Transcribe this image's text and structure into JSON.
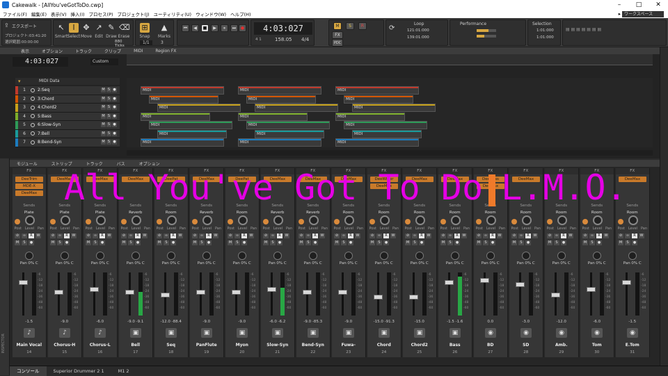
{
  "titlebar": {
    "title": "Cakewalk - [AllYou'veGotToDo.cwp]"
  },
  "menu": {
    "items": [
      "ファイル(F)",
      "編集(E)",
      "表示(V)",
      "挿入(I)",
      "プロセス(P)",
      "プロジェクト(J)",
      "ユーティリティ(U)",
      "ウィンドウ(W)",
      "ヘルプ(H)"
    ],
    "workspace_label": "ワークスペース"
  },
  "control": {
    "export_label": "エクスポート",
    "project_line": "プロジェクト:03:41:20",
    "selection_line": "選択範囲:00:00:00",
    "tools": [
      "Smart",
      "Select",
      "Move",
      "Edit",
      "Draw",
      "Erase"
    ],
    "snap_label": "Snap",
    "snap_value": "1/1",
    "marks_label": "Marks",
    "ticks_value": "880 Ticks",
    "marks_value": "3",
    "time": "4:03:027",
    "bpm": "158.05",
    "meter": "4/4",
    "bar_info": "4 1",
    "loop_title": "Loop",
    "loop_start": "121:01:000",
    "loop_end": "139:01:000",
    "performance_title": "Performance",
    "selection_title": "Selection",
    "sel_start": "1:01:000",
    "sel_end": "1:01:000",
    "mode_buttons": [
      "M",
      "S",
      "R",
      "FX",
      "PDC"
    ]
  },
  "trackview": {
    "menu": [
      "表示",
      "オプション",
      "トラック",
      "クリップ",
      "MIDI",
      "Region FX"
    ],
    "clock": "4:03:027",
    "preset": "Custom",
    "folder_name": "MIDI Data",
    "tracks": [
      {
        "num": "1",
        "name": "2:Seq",
        "color": "#c0392b"
      },
      {
        "num": "2",
        "name": "3:Chord",
        "color": "#d35400"
      },
      {
        "num": "3",
        "name": "4:Chord2",
        "color": "#c8a21a"
      },
      {
        "num": "4",
        "name": "5:Bass",
        "color": "#7cae2a"
      },
      {
        "num": "5",
        "name": "6:Slow-Syn",
        "color": "#2e9a58"
      },
      {
        "num": "6",
        "name": "7:Bell",
        "color": "#1a9a9a"
      },
      {
        "num": "7",
        "name": "8:Bend-Syn",
        "color": "#1c7cbf"
      }
    ],
    "clip_label": "MIDI"
  },
  "console": {
    "menu": [
      "モジュール",
      "ストリップ",
      "トラック",
      "バス",
      "オプション"
    ],
    "strips": [
      {
        "name": "Main Vocal",
        "num": "14",
        "fx": [
          "DeeTrim",
          "MDE-X",
          "DeeMax"
        ],
        "send": "Plate",
        "vol": "-1.5",
        "vol2": "",
        "fader": 0.8,
        "meter": 0,
        "inst": "♪"
      },
      {
        "name": "Chorus-H",
        "num": "15",
        "fx": [
          "DeeMax"
        ],
        "send": "Plate",
        "vol": "-9.0",
        "vol2": "",
        "fader": 0.55,
        "meter": 0,
        "inst": "♪"
      },
      {
        "name": "Chorus-L",
        "num": "16",
        "fx": [
          "DeeMax"
        ],
        "send": "Plate",
        "vol": "-6.0",
        "vol2": "",
        "fader": 0.62,
        "meter": 0,
        "inst": "♪"
      },
      {
        "name": "Bell",
        "num": "17",
        "fx": [
          "DeeMax"
        ],
        "send": "Reverb",
        "vol": "-9.0",
        "vol2": "-9.1",
        "fader": 0.55,
        "meter": 0.55,
        "inst": "▣"
      },
      {
        "name": "Seq",
        "num": "18",
        "fx": [
          "DeePat"
        ],
        "send": "Room",
        "vol": "-12.0",
        "vol2": "-88.4",
        "fader": 0.48,
        "meter": 0,
        "inst": "▣"
      },
      {
        "name": "PanFlute",
        "num": "19",
        "fx": [
          "DeeMax"
        ],
        "send": "Reverb",
        "vol": "-9.0",
        "vol2": "",
        "fader": 0.55,
        "meter": 0,
        "inst": "▣"
      },
      {
        "name": "Myon",
        "num": "20",
        "fx": [
          "DeePat"
        ],
        "send": "Room",
        "vol": "-9.0",
        "vol2": "",
        "fader": 0.55,
        "meter": 0,
        "inst": "▣"
      },
      {
        "name": "Slow-Syn",
        "num": "21",
        "fx": [
          "DeeMax"
        ],
        "send": "Reverb",
        "vol": "-6.0",
        "vol2": "-6.2",
        "fader": 0.62,
        "meter": 0.65,
        "inst": "▣"
      },
      {
        "name": "Bend-Syn",
        "num": "22",
        "fx": [
          "DeeMax"
        ],
        "send": "Reverb",
        "vol": "-9.0",
        "vol2": "-85.3",
        "fader": 0.55,
        "meter": 0,
        "inst": "▣"
      },
      {
        "name": "Fuwa-",
        "num": "23",
        "fx": [
          "DeeMax"
        ],
        "send": "Room",
        "vol": "-9.0",
        "vol2": "",
        "fader": 0.55,
        "meter": 0,
        "inst": "▣"
      },
      {
        "name": "Chord",
        "num": "24",
        "fx": [
          "DeeWider",
          "DeeMax"
        ],
        "send": "Room",
        "vol": "-15.0",
        "vol2": "-91.3",
        "fader": 0.42,
        "meter": 0,
        "inst": "▣"
      },
      {
        "name": "Chord2",
        "num": "25",
        "fx": [
          "DeeMax"
        ],
        "send": "Room",
        "vol": "-15.0",
        "vol2": "",
        "fader": 0.42,
        "meter": 0,
        "inst": "▣"
      },
      {
        "name": "Bass",
        "num": "26",
        "fx": [
          "DeeMax"
        ],
        "send": "Room",
        "vol": "-1.5",
        "vol2": "-1.6",
        "fader": 0.8,
        "meter": 0.9,
        "inst": "▣"
      },
      {
        "name": "BD",
        "num": "27",
        "fx": [
          "DeeBass",
          "DeeMax"
        ],
        "send": "Room",
        "vol": "0.0",
        "vol2": "",
        "fader": 0.85,
        "meter": 0,
        "inst": "◉"
      },
      {
        "name": "SD",
        "num": "28",
        "fx": [
          "DeeMax"
        ],
        "send": "Room",
        "vol": "-3.0",
        "vol2": "",
        "fader": 0.75,
        "meter": 0,
        "inst": "◉"
      },
      {
        "name": "Amb.",
        "num": "29",
        "fx": [],
        "send": "Room",
        "vol": "-12.0",
        "vol2": "",
        "fader": 0.48,
        "meter": 0,
        "inst": "◉"
      },
      {
        "name": "Tom",
        "num": "30",
        "fx": [],
        "send": "Room",
        "vol": "-6.0",
        "vol2": "",
        "fader": 0.62,
        "meter": 0,
        "inst": "◉"
      },
      {
        "name": "E.Tom",
        "num": "31",
        "fx": [
          "DeeMax"
        ],
        "send": "Room",
        "vol": "-1.5",
        "vol2": "",
        "fader": 0.8,
        "meter": 0,
        "inst": "◉"
      }
    ],
    "fx_header": "FX",
    "sends_label": "Sends",
    "knob_labels": [
      "Post",
      "Level",
      "Pan"
    ],
    "pan_label": "Pan 0% C",
    "meter_ticks": [
      "-6",
      "-12",
      "-18",
      "-24",
      "-36",
      "-48",
      "-60"
    ]
  },
  "overlay_text": {
    "left": "All You've Got To Do",
    "right": "L.M.O."
  },
  "bottom_tabs": [
    "コンソール",
    "Superior Drummer 2 1",
    "M1 2"
  ],
  "inspector_label": "INSPECTOR"
}
